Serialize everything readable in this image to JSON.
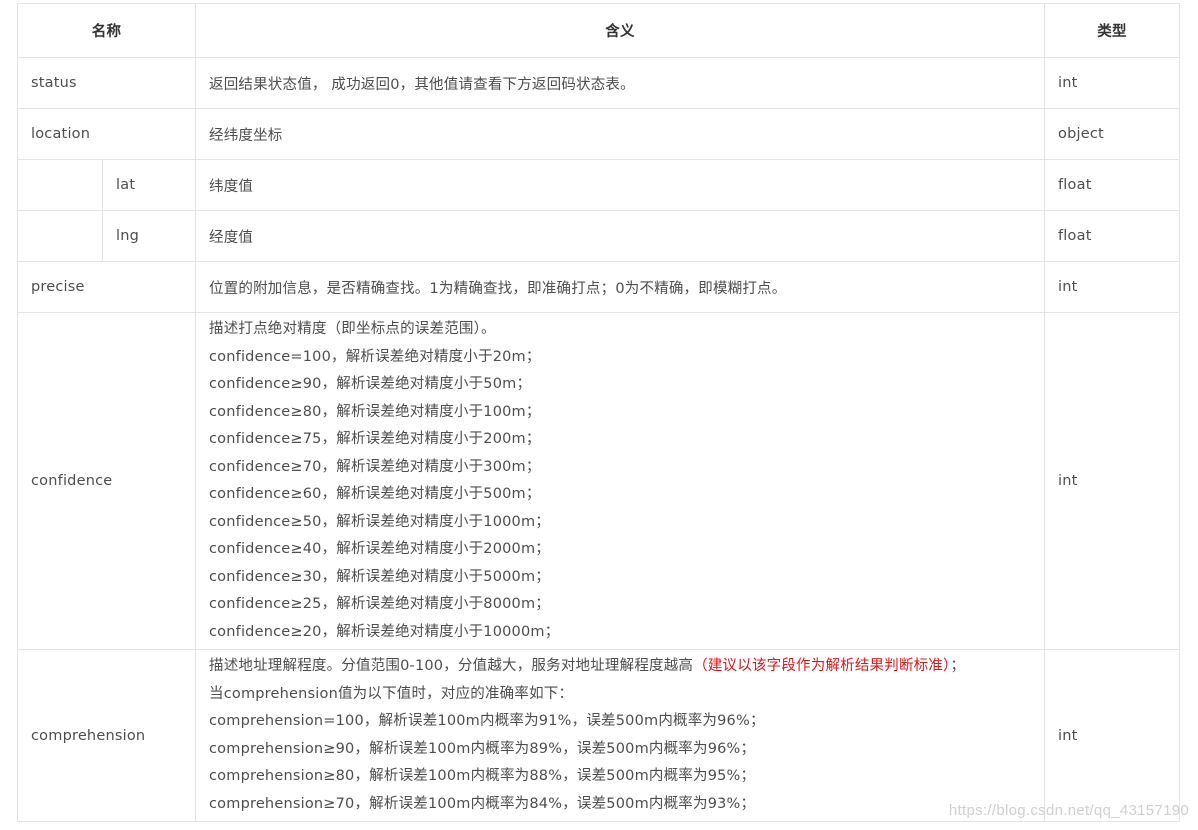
{
  "headers": {
    "name": "名称",
    "meaning": "含义",
    "type": "类型"
  },
  "rows": {
    "status": {
      "name": "status",
      "meaning": "返回结果状态值， 成功返回0，其他值请查看下方返回码状态表。",
      "type": "int"
    },
    "location": {
      "name": "location",
      "meaning": "经纬度坐标",
      "type": "object"
    },
    "lat": {
      "name": "lat",
      "meaning": "纬度值",
      "type": "float"
    },
    "lng": {
      "name": "lng",
      "meaning": "经度值",
      "type": "float"
    },
    "precise": {
      "name": "precise",
      "meaning": "位置的附加信息，是否精确查找。1为精确查找，即准确打点；0为不精确，即模糊打点。",
      "type": "int"
    },
    "confidence": {
      "name": "confidence",
      "lines": [
        "描述打点绝对精度（即坐标点的误差范围）。",
        "confidence=100，解析误差绝对精度小于20m；",
        "confidence≥90，解析误差绝对精度小于50m；",
        "confidence≥80，解析误差绝对精度小于100m；",
        "confidence≥75，解析误差绝对精度小于200m；",
        "confidence≥70，解析误差绝对精度小于300m；",
        "confidence≥60，解析误差绝对精度小于500m；",
        "confidence≥50，解析误差绝对精度小于1000m；",
        "confidence≥40，解析误差绝对精度小于2000m；",
        "confidence≥30，解析误差绝对精度小于5000m；",
        "confidence≥25，解析误差绝对精度小于8000m；",
        "confidence≥20，解析误差绝对精度小于10000m；"
      ],
      "type": "int"
    },
    "comprehension": {
      "name": "comprehension",
      "intro": "描述地址理解程度。分值范围0-100，分值越大，服务对地址理解程度越高",
      "intro_highlight": "（建议以该字段作为解析结果判断标准）",
      "intro_end": "；",
      "lines": [
        "当comprehension值为以下值时，对应的准确率如下：",
        "comprehension=100，解析误差100m内概率为91%，误差500m内概率为96%；",
        "comprehension≥90，解析误差100m内概率为89%，误差500m内概率为96%；",
        "comprehension≥80，解析误差100m内概率为88%，误差500m内概率为95%；",
        "comprehension≥70，解析误差100m内概率为84%，误差500m内概率为93%；"
      ],
      "type": "int"
    }
  },
  "watermark": "https://blog.csdn.net/qq_43157190",
  "colors": {
    "border": "#e4e4e4",
    "text": "#4d4d4d",
    "header_text": "#333333",
    "highlight": "#e0161a"
  }
}
